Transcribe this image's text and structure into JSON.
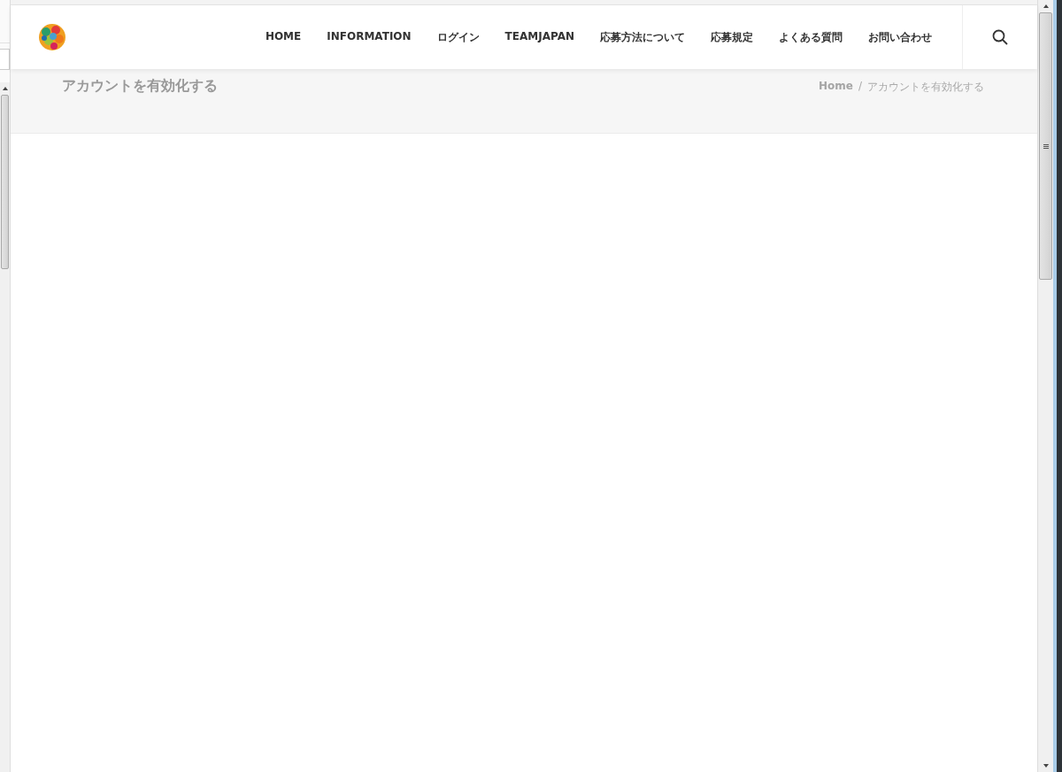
{
  "header": {
    "nav": [
      {
        "label": "HOME"
      },
      {
        "label": "INFORMATION"
      },
      {
        "label": "ログイン"
      },
      {
        "label": "TEAMJAPAN"
      },
      {
        "label": "応募方法について"
      },
      {
        "label": "応募規定"
      },
      {
        "label": "よくある質問"
      },
      {
        "label": "お問い合わせ"
      }
    ]
  },
  "page_title": "アカウントを有効化する",
  "breadcrumb": {
    "home": "Home",
    "separator": "/",
    "current": "アカウントを有効化する"
  }
}
